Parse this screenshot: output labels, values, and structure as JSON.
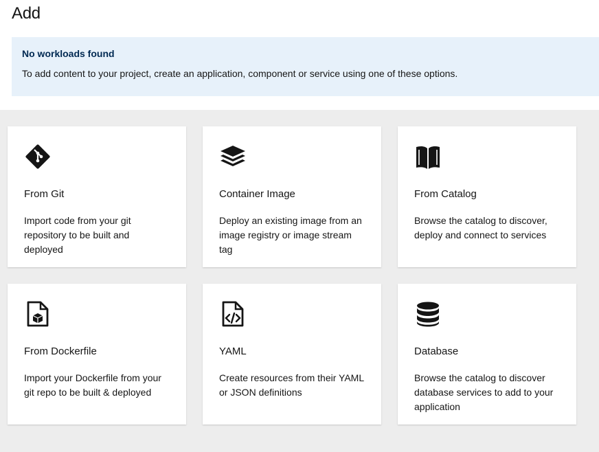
{
  "page": {
    "title": "Add"
  },
  "alert": {
    "title": "No workloads found",
    "body": "To add content to your project, create an application, component or service using one of these options."
  },
  "cards": [
    {
      "icon": "git-icon",
      "title": "From Git",
      "description": "Import code from your git repository to be built and deployed"
    },
    {
      "icon": "layers-icon",
      "title": "Container Image",
      "description": "Deploy an existing image from an image registry or image stream tag"
    },
    {
      "icon": "open-book-icon",
      "title": "From Catalog",
      "description": "Browse the catalog to discover, deploy and connect to services"
    },
    {
      "icon": "dockerfile-icon",
      "title": "From Dockerfile",
      "description": "Import your Dockerfile from your git repo to be built & deployed"
    },
    {
      "icon": "code-file-icon",
      "title": "YAML",
      "description": "Create resources from their YAML or JSON definitions"
    },
    {
      "icon": "database-icon",
      "title": "Database",
      "description": "Browse the catalog to discover database services to add to your application"
    }
  ]
}
